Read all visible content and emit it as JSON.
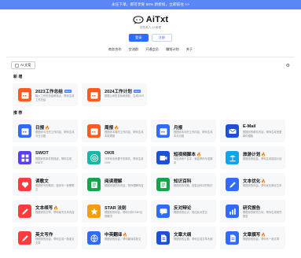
{
  "banner": {
    "text": "永任下单，即可享受 50% 新折扣，立即前往 >>"
  },
  "brand": {
    "name": "AiTxt",
    "subtitle": "您的私人 AI 助理"
  },
  "auth": {
    "login": "登录",
    "register": "注册"
  },
  "nav": [
    "商务合作",
    "交流群",
    "开通会员",
    "赚钱计划",
    "关于"
  ],
  "toolbar": {
    "tag_label": "AI 文案",
    "settings_icon": "settings-icon"
  },
  "sections": {
    "new": {
      "title": "新 增",
      "items": [
        {
          "title": "2023工作总结",
          "badge": "NEW",
          "desc": "输入工作的总结和特点，帮你生成工作总结",
          "icon": "calendar-icon",
          "color": "#ff5a1f"
        },
        {
          "title": "2024工作计划",
          "badge": "NEW",
          "desc": "根据公司的目标和规划，生成OKR",
          "icon": "calendar-icon",
          "color": "#ff5a1f"
        }
      ]
    },
    "all": {
      "title": "推 荐",
      "items": [
        {
          "title": "日报",
          "hot": "🔥",
          "desc": "根据你今日的工作内容，帮你生成今日日报",
          "icon": "calendar-icon",
          "color": "#2f6bff"
        },
        {
          "title": "周报",
          "hot": "🔥",
          "desc": "根据你本周的工作内容，帮你生成本周周报",
          "icon": "calendar-icon",
          "color": "#ff5a1f"
        },
        {
          "title": "月报",
          "hot": "",
          "desc": "根据你本月的工作内容，帮你生成本月月报",
          "icon": "calendar-icon",
          "color": "#2f6bff"
        },
        {
          "title": "E-Mail",
          "hot": "",
          "desc": "根据你的邮件内容，帮你生成完整邮件模板",
          "icon": "mail-icon",
          "color": "#1d4fd8"
        },
        {
          "title": "SWOT",
          "hot": "",
          "desc": "根据你的事件的描述，帮你生成SWOT",
          "icon": "grid-icon",
          "color": "#5b3ef0"
        },
        {
          "title": "OKR",
          "hot": "",
          "desc": "分享你未来要干的事情，帮你生成OKR",
          "icon": "target-icon",
          "color": "#14b8a6"
        },
        {
          "title": "短视频脚本",
          "hot": "🔥",
          "desc": "你告诉你个名字，就能帮你写成脚本",
          "icon": "video-icon",
          "color": "#1d4fd8"
        },
        {
          "title": "旅游计划",
          "hot": "🔥",
          "desc": "根据你的信息，帮你生成旅游计划",
          "icon": "beach-icon",
          "color": "#0ea5e9"
        },
        {
          "title": "读歌文",
          "hot": "",
          "desc": "根据你写的歌词，给你写一篇歌歌文",
          "icon": "heart-icon",
          "color": "#ff3b3b"
        },
        {
          "title": "阅读理解",
          "hot": "",
          "desc": "根据你提供的内容，帮你理解内容",
          "icon": "book-icon",
          "color": "#16a34a"
        },
        {
          "title": "知识百科",
          "hot": "",
          "desc": "根据你的问题，回答百科中的知识",
          "icon": "book-icon",
          "color": "#16a34a"
        },
        {
          "title": "文本优化",
          "hot": "🔥",
          "desc": "根据你的内容，帮你优化美化文本",
          "icon": "pen-icon",
          "color": "#2f6bff"
        },
        {
          "title": "文本续写",
          "hot": "🔥",
          "desc": "根据你的文章，帮你续写文本内容",
          "icon": "pen-icon",
          "color": "#ff3b3b"
        },
        {
          "title": "STAR 法则",
          "hot": "",
          "desc": "根据你的内容，帮你分析STAR法则解决",
          "icon": "star-icon",
          "color": "#f59e0b"
        },
        {
          "title": "反对辩论",
          "hot": "",
          "desc": "根据你的论点，提出反对意见",
          "icon": "chat-icon",
          "color": "#2f6bff"
        },
        {
          "title": "研究报告",
          "hot": "",
          "desc": "根据你的研究方向，帮你生成研究报告",
          "icon": "chart-icon",
          "color": "#2f6bff"
        },
        {
          "title": "英文写作",
          "hot": "",
          "desc": "根据你的内容，帮你生成一篇英文文章",
          "icon": "pen-icon",
          "color": "#ff3b3b"
        },
        {
          "title": "中英翻译",
          "hot": "🔥",
          "desc": "根据你的内容，帮你翻译成英文",
          "icon": "globe-icon",
          "color": "#2f6bff"
        },
        {
          "title": "文章大纲",
          "hot": "",
          "desc": "根据你的主题，帮你生成文章大纲",
          "icon": "doc-icon",
          "color": "#1d4fd8"
        },
        {
          "title": "文章撰写",
          "hot": "🔥",
          "desc": "根据你的内容，帮你写一篇文章",
          "icon": "doc-icon",
          "color": "#2f6bff"
        }
      ]
    }
  }
}
